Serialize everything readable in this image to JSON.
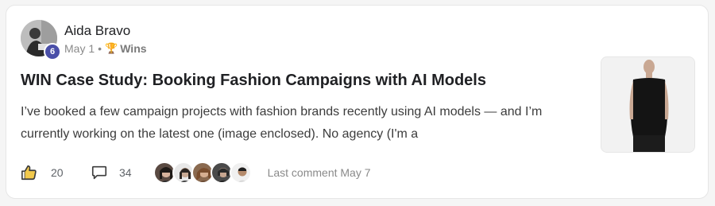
{
  "author": {
    "name": "Aida Bravo",
    "level": "6"
  },
  "meta": {
    "date": "May 1",
    "separator": "•",
    "category_icon": "trophy-icon",
    "category": "Wins"
  },
  "post": {
    "title": "WIN Case Study: Booking Fashion Campaigns with AI Models",
    "excerpt": "I’ve booked a few campaign projects with fashion brands recently using AI models — and I’m currently working on the latest one (image enclosed). No agency (I'm a"
  },
  "footer": {
    "like_icon": "thumbs-up-icon",
    "likes": "20",
    "comment_icon": "comment-bubble-icon",
    "comments": "34",
    "last_comment": "Last comment May 7"
  },
  "colors": {
    "level_badge": "#4a4fa8",
    "title": "#202124",
    "muted": "#8a8a8a"
  }
}
